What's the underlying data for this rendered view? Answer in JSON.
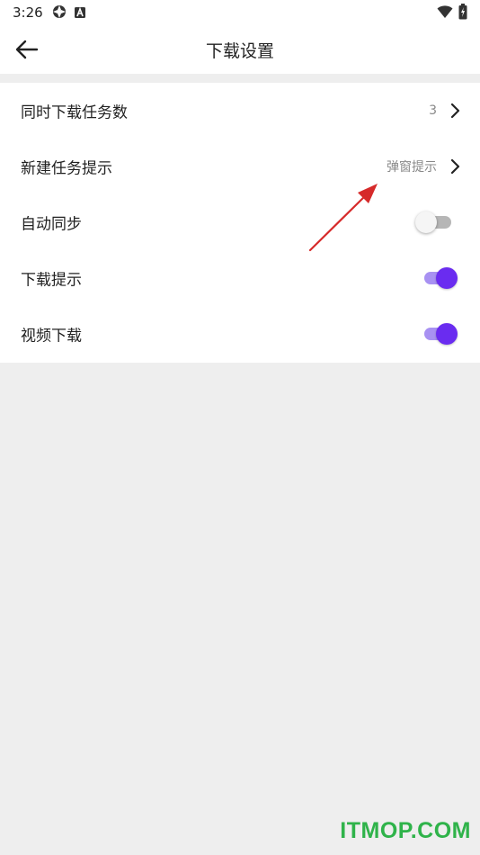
{
  "status_bar": {
    "time": "3:26",
    "left_icons": [
      "settings-icon",
      "a-badge-icon"
    ],
    "right_icons": [
      "wifi-icon",
      "battery-icon"
    ]
  },
  "app_bar": {
    "title": "下载设置",
    "back_icon": "back-arrow-icon"
  },
  "settings": {
    "concurrent_downloads": {
      "label": "同时下载任务数",
      "value": "3"
    },
    "new_task_prompt": {
      "label": "新建任务提示",
      "value": "弹窗提示"
    },
    "auto_sync": {
      "label": "自动同步",
      "enabled": false
    },
    "download_prompt": {
      "label": "下载提示",
      "enabled": true
    },
    "video_download": {
      "label": "视频下载",
      "enabled": true
    }
  },
  "colors": {
    "accent": "#6a2cf0",
    "accent_track": "#a891f2",
    "annotation_arrow": "#d62a2a",
    "watermark": "#2fb34a",
    "background": "#eeeeee"
  },
  "watermark": "ITMOP.COM"
}
